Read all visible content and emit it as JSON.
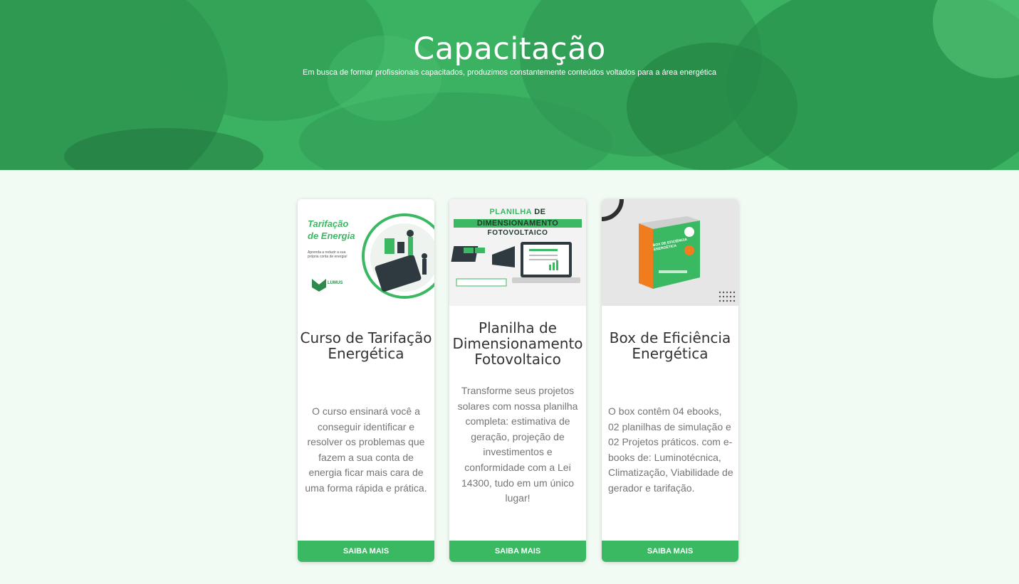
{
  "hero": {
    "title": "Capacitação",
    "subtitle": "Em busca de formar profissionais capacitados, produzimos constantemente conteúdos voltados para a área energética"
  },
  "colors": {
    "hero_green": "#3bb261",
    "button_green": "#3bb862",
    "page_bg": "#f2faf4"
  },
  "cards": [
    {
      "image_text": {
        "title_line1": "Tarifação",
        "title_line2": "de Energia",
        "tagline": "Aprenda a reduzir a sua própria conta de energia!",
        "logo": "LUMUS"
      },
      "title": "Curso de Tarifação Energética",
      "description": "O curso ensinará você a conseguir identificar e resolver os problemas que fazem a sua conta de energia ficar mais cara de uma forma rápida e prática.",
      "button": "SAIBA MAIS"
    },
    {
      "image_text": {
        "line1a": "PLANILHA",
        "line1b": "DE",
        "line2": "DIMENSIONAMENTO",
        "line3": "FOTOVOLTAICO"
      },
      "title": "Planilha de Dimensionamento Fotovoltaico",
      "description": "Transforme seus projetos solares com nossa planilha completa: estimativa de geração, projeção de investimentos e conformidade com a Lei 14300, tudo em um único lugar!",
      "button": "SAIBA MAIS"
    },
    {
      "image_text": {
        "box_label": "BOX DE EFICIÊNCIA ENERGÉTICA"
      },
      "title": "Box de Eficiência Energética",
      "description": "O box contêm 04 ebooks, 02 planilhas de simulação e 02 Projetos práticos. com e-books de: Luminotécnica, Climatização, Viabilidade de gerador e tarifação.",
      "button": "SAIBA MAIS"
    }
  ]
}
